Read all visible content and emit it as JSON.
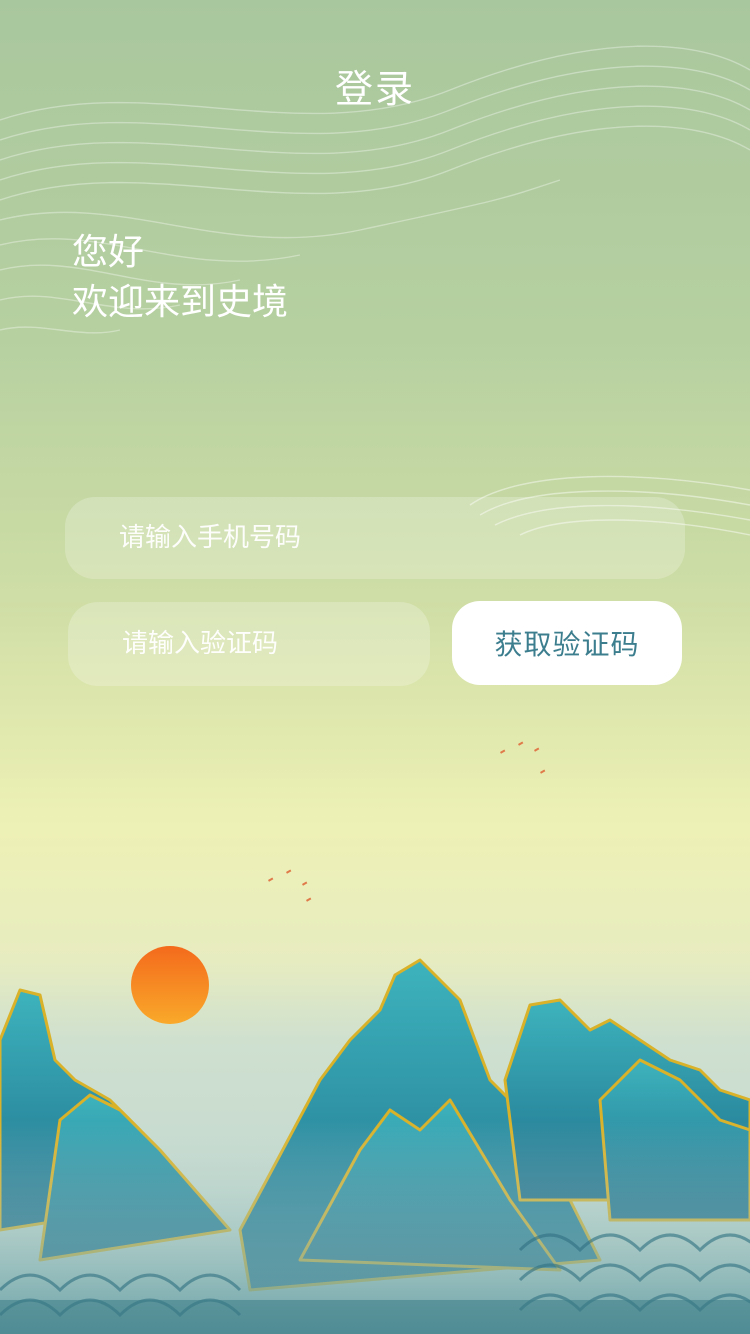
{
  "header": {
    "title": "登录"
  },
  "greeting": {
    "line1": "您好",
    "line2": "欢迎来到史境"
  },
  "form": {
    "phone_placeholder": "请输入手机号码",
    "code_placeholder": "请输入验证码",
    "get_code_label": "获取验证码"
  },
  "colors": {
    "button_text": "#3c7d8e",
    "mountain": "#2a8ea4",
    "mountain_outline": "#d9b22a",
    "sun": "#f47a1e"
  }
}
